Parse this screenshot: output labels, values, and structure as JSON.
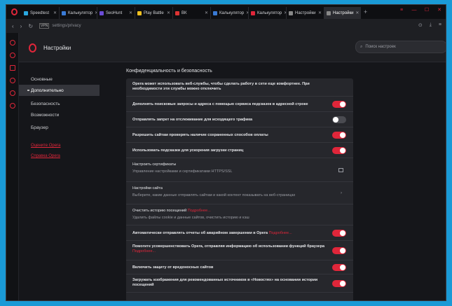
{
  "tabs": [
    {
      "label": "Speedtest",
      "color": "#2aa8e0"
    },
    {
      "label": "Калькулятор",
      "color": "#3a7bd5"
    },
    {
      "label": "SeoHunt",
      "color": "#6b4cd6"
    },
    {
      "label": "Play Battle",
      "color": "#f0c020"
    },
    {
      "label": "ВК",
      "color": "#d33"
    },
    {
      "label": "Калькулятор",
      "color": "#3a7bd5"
    },
    {
      "label": "Калькулятор",
      "color": "#e0263a"
    },
    {
      "label": "Настройки",
      "color": "#888"
    },
    {
      "label": "Настройки",
      "color": "#888"
    }
  ],
  "address": {
    "badge": "VPN",
    "url": "settings/privacy"
  },
  "header": {
    "title": "Настройки",
    "search_placeholder": "Поиск настроек"
  },
  "nav": {
    "items": [
      "Основные",
      "Дополнительно",
      "Безопасность",
      "Возможности",
      "Браузер"
    ],
    "links": [
      "Оцените Opera",
      "Справка Opera"
    ]
  },
  "section_title": "Конфиденциальность и безопасность",
  "rows": [
    {
      "title": "Opera может использовать веб-службы, чтобы сделать работу в сети еще комфортнее. При необходимости эти службы можно отключить",
      "toggle": null
    },
    {
      "title": "Дополнять поисковые запросы и адреса с помощью сервиса подсказок в адресной строке",
      "toggle": "on"
    },
    {
      "title": "Отправлять запрет на отслеживание для исходящего трафика",
      "toggle": "off"
    },
    {
      "title": "Разрешить сайтам проверять наличие сохраненных способов оплаты",
      "toggle": "on"
    },
    {
      "title": "Использовать подсказки для ускорения загрузки страниц",
      "toggle": "on"
    },
    {
      "title": "Настроить сертификаты",
      "sub": "Управление настройками и сертификатами HTTPS/SSL",
      "toggle": "ext"
    },
    {
      "title": "Настройки сайта",
      "sub": "Выберите, какие данные отправлять сайтам и какой контент показывать на веб-страницах",
      "toggle": "chev"
    },
    {
      "title": "Очистить историю посещений",
      "more": "Подробнее...",
      "sub": "Удалить файлы cookie и данные сайтов, очистить историю и кэш",
      "toggle": null
    },
    {
      "title": "Автоматически отправлять отчеты об аварийном завершении в Opera",
      "more": "Подробнее...",
      "toggle": "on"
    },
    {
      "title": "Помогите усовершенствовать Opera, отправляя информацию об использовании функций браузера",
      "more": "Подробнее...",
      "toggle": "on"
    },
    {
      "title": "Включить защиту от вредоносных сайтов",
      "toggle": "on"
    },
    {
      "title": "Загружать изображения для рекомендованных источников в «Новостях» на основании истории посещений",
      "toggle": "on"
    }
  ]
}
